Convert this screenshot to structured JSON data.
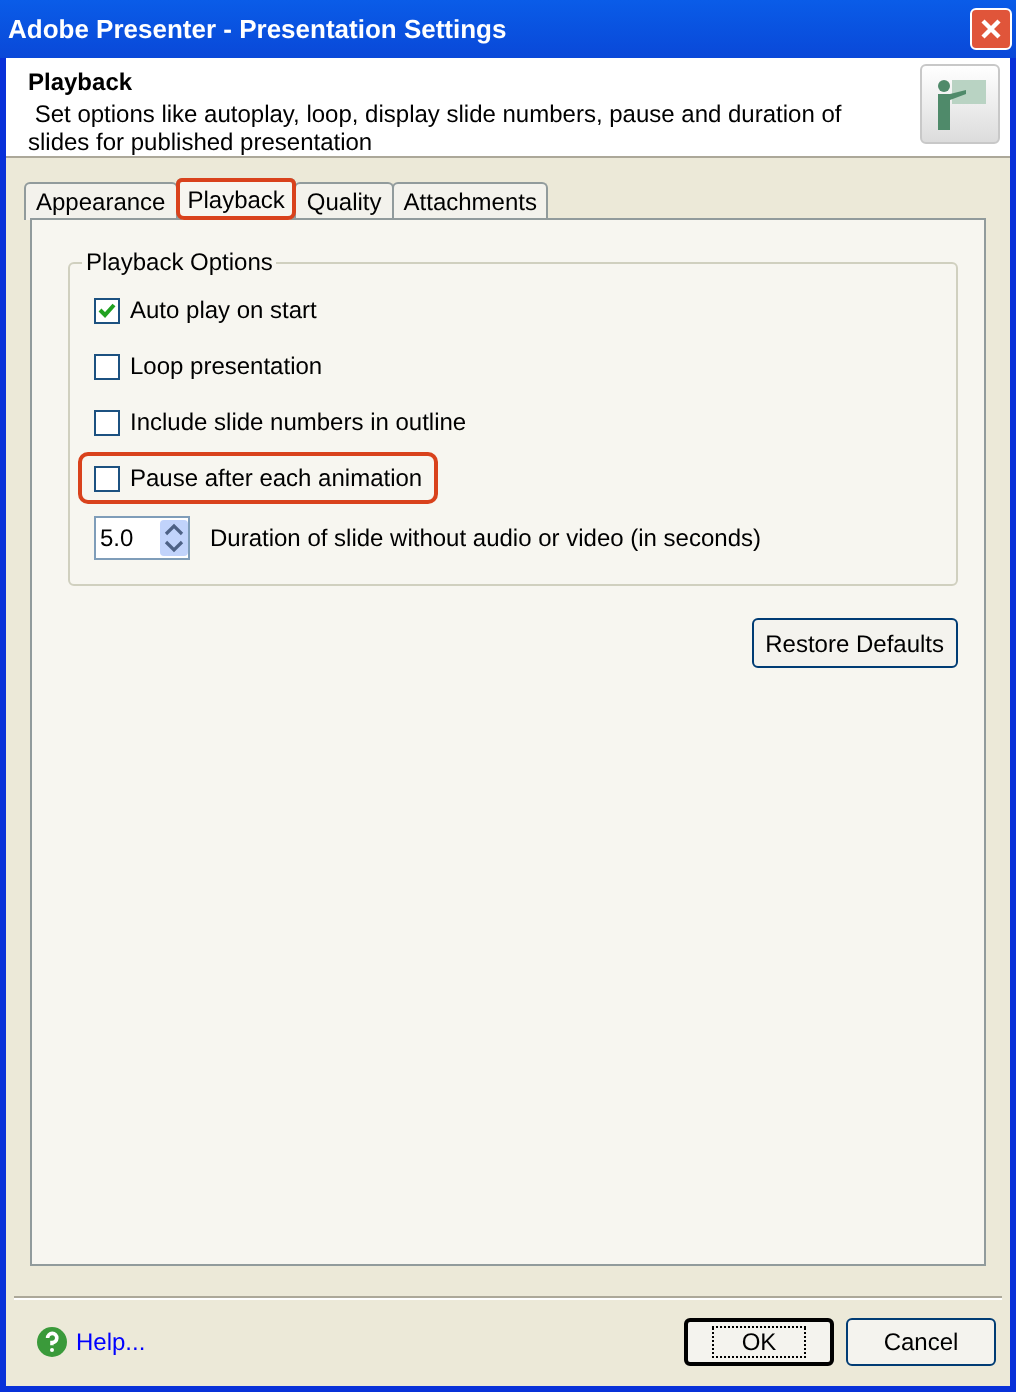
{
  "window": {
    "title": "Adobe Presenter - Presentation Settings"
  },
  "header": {
    "title": "Playback",
    "description": " Set options like autoplay, loop, display slide numbers, pause and duration of slides for published presentation"
  },
  "tabs": [
    {
      "label": "Appearance",
      "selected": false,
      "highlighted": false
    },
    {
      "label": "Playback",
      "selected": true,
      "highlighted": true
    },
    {
      "label": "Quality",
      "selected": false,
      "highlighted": false
    },
    {
      "label": "Attachments",
      "selected": false,
      "highlighted": false
    }
  ],
  "group": {
    "title": "Playback Options",
    "options": [
      {
        "kind": "checkbox",
        "label": "Auto play on start",
        "checked": true,
        "highlighted": false
      },
      {
        "kind": "checkbox",
        "label": "Loop presentation",
        "checked": false,
        "highlighted": false
      },
      {
        "kind": "checkbox",
        "label": "Include slide numbers in outline",
        "checked": false,
        "highlighted": false
      },
      {
        "kind": "checkbox",
        "label": "Pause after each animation",
        "checked": false,
        "highlighted": true
      },
      {
        "kind": "spin",
        "spinner": {
          "value": "5.0"
        },
        "caption": "Duration of slide without audio or video (in seconds)",
        "highlighted": false
      }
    ]
  },
  "restore_button": "Restore Defaults",
  "help_link": "Help...",
  "buttons": [
    {
      "label": "OK",
      "default": true
    },
    {
      "label": "Cancel",
      "default": false
    }
  ]
}
